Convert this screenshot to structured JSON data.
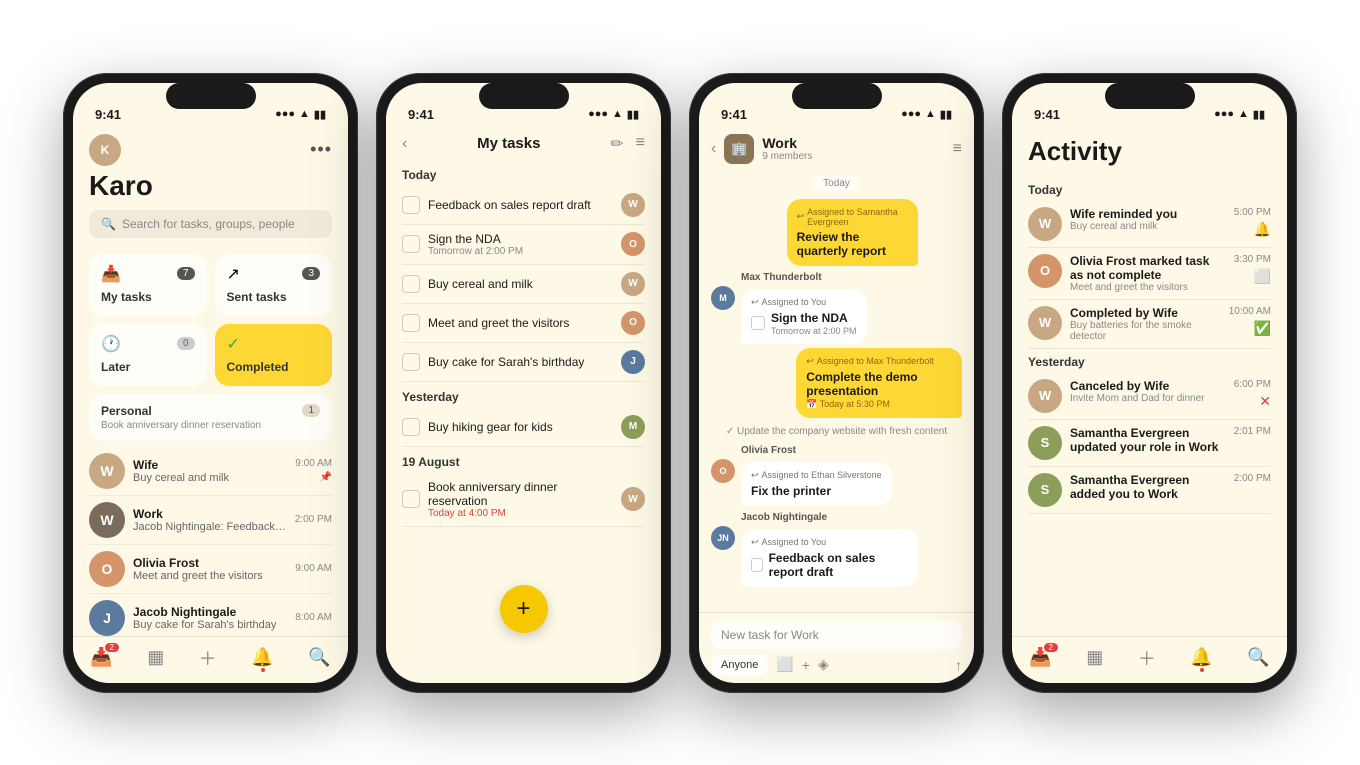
{
  "phones": [
    {
      "id": "phone1",
      "statusBar": {
        "time": "9:41",
        "signal": "●●● ▲ WiFi ▮▮▮"
      },
      "header": {
        "userName": "Karo",
        "searchPlaceholder": "Search for tasks, groups, people"
      },
      "cards": [
        {
          "id": "my-tasks",
          "icon": "📥",
          "label": "My tasks",
          "badge": "7",
          "accent": false
        },
        {
          "id": "sent-tasks",
          "icon": "↗",
          "label": "Sent tasks",
          "badge": "3",
          "accent": false
        },
        {
          "id": "later",
          "icon": "🕐",
          "label": "Later",
          "badge": "0",
          "accent": false
        },
        {
          "id": "completed",
          "icon": "✓",
          "label": "Completed",
          "badge": "",
          "accent": true
        }
      ],
      "section": {
        "title": "Personal",
        "subtitle": "Book anniversary dinner reservation",
        "badge": "1"
      },
      "inboxItems": [
        {
          "id": "wife",
          "name": "Wife",
          "msg": "Buy cereal and milk",
          "time": "9:00 AM",
          "avatarBg": "#c8a882",
          "initial": "W",
          "pinned": true
        },
        {
          "id": "work",
          "name": "Work",
          "msg": "Jacob Nightingale: Feedback on sales rep...",
          "time": "2:00 PM",
          "avatarBg": "#7b6b5a",
          "initial": "W",
          "pinned": false
        },
        {
          "id": "olivia",
          "name": "Olivia Frost",
          "msg": "Meet and greet the visitors",
          "time": "9:00 AM",
          "avatarBg": "#d4956a",
          "initial": "O",
          "pinned": false
        },
        {
          "id": "jacob",
          "name": "Jacob Nightingale",
          "msg": "Buy cake for Sarah's birthday",
          "time": "8:00 AM",
          "avatarBg": "#5a7a9e",
          "initial": "J",
          "pinned": false
        }
      ],
      "nav": [
        {
          "icon": "📥",
          "active": true,
          "badge": "2"
        },
        {
          "icon": "▦",
          "active": false
        },
        {
          "icon": "＋",
          "active": false
        },
        {
          "icon": "🔔",
          "active": false,
          "dot": true
        },
        {
          "icon": "🔍",
          "active": false
        }
      ]
    },
    {
      "id": "phone2",
      "statusBar": {
        "time": "9:41"
      },
      "header": {
        "title": "My tasks"
      },
      "sections": [
        {
          "label": "Today",
          "tasks": [
            {
              "name": "Feedback on sales report draft",
              "sub": "",
              "avatarBg": "#c8a882",
              "initial": "W"
            },
            {
              "name": "Sign the NDA",
              "sub": "Tomorrow at 2:00 PM",
              "avatarBg": "#d4956a",
              "initial": "O"
            },
            {
              "name": "Buy cereal and milk",
              "sub": "",
              "avatarBg": "#c8a882",
              "initial": "W"
            },
            {
              "name": "Meet and greet the visitors",
              "sub": "",
              "avatarBg": "#d4956a",
              "initial": "O"
            },
            {
              "name": "Buy cake for Sarah's birthday",
              "sub": "",
              "avatarBg": "#5a7a9e",
              "initial": "J"
            }
          ]
        },
        {
          "label": "Yesterday",
          "tasks": [
            {
              "name": "Buy hiking gear for kids",
              "sub": "",
              "avatarBg": "#8b9e5a",
              "initial": "M"
            }
          ]
        },
        {
          "label": "19 August",
          "tasks": [
            {
              "name": "Book anniversary dinner reservation",
              "sub": "Today at 4:00 PM",
              "subRed": true,
              "avatarBg": "#c8a882",
              "initial": "W"
            }
          ]
        }
      ],
      "fab": "+"
    },
    {
      "id": "phone3",
      "statusBar": {
        "time": "9:41"
      },
      "header": {
        "title": "Work",
        "sub": "9 members"
      },
      "messages": [
        {
          "type": "date",
          "text": "Today"
        },
        {
          "type": "outgoing-task",
          "assigned": "Assigned to Samantha Evergreen",
          "taskName": "Review the quarterly report",
          "taskSub": ""
        },
        {
          "type": "incoming-block",
          "sender": "Max Thunderbolt",
          "avatarBg": "#5a7a9e",
          "initial": "M",
          "bubbles": [
            {
              "assigned": "Assigned to You",
              "taskName": "Sign the NDA",
              "taskSub": "Tomorrow at 2:00 PM",
              "checkbox": true
            }
          ]
        },
        {
          "type": "incoming-block",
          "sender": "",
          "avatarBg": "#5a7a9e",
          "initial": "M",
          "bubbles": [
            {
              "assigned": "Assigned to Max Thunderbolt",
              "taskName": "Complete the demo presentation",
              "taskSub": "Today at 5:30 PM",
              "taskSubRed": false,
              "checkbox": false,
              "yellow": true
            }
          ]
        },
        {
          "type": "update",
          "text": "✓ Update the company website with fresh content"
        },
        {
          "type": "incoming-block",
          "sender": "Olivia Frost",
          "avatarBg": "#d4956a",
          "initial": "O",
          "bubbles": [
            {
              "assigned": "Assigned to Ethan Silverstone",
              "taskName": "Fix the printer",
              "taskSub": "",
              "checkbox": false
            }
          ]
        },
        {
          "type": "incoming-block",
          "sender": "Jacob Nightingale",
          "avatarBg": "#5a7a9e",
          "initial": "JN",
          "bubbles": [
            {
              "assigned": "Assigned to You",
              "taskName": "Feedback on sales report draft",
              "taskSub": "",
              "checkbox": true
            }
          ]
        }
      ],
      "newTask": {
        "placeholder": "New task for Work"
      },
      "toolbar": [
        {
          "label": "Anyone",
          "type": "button"
        },
        {
          "icon": "⬜",
          "type": "icon"
        },
        {
          "icon": "+",
          "type": "icon"
        },
        {
          "icon": "◈",
          "type": "icon"
        },
        {
          "icon": "↑",
          "type": "icon"
        }
      ]
    },
    {
      "id": "phone4",
      "statusBar": {
        "time": "9:41"
      },
      "header": {
        "title": "Activity"
      },
      "sections": [
        {
          "label": "Today",
          "items": [
            {
              "actor": "Wife reminded you",
              "sub": "Buy cereal and milk",
              "time": "5:00 PM",
              "iconType": "bell",
              "avatarBg": "#c8a882",
              "initial": "W"
            },
            {
              "actor": "Olivia Frost marked task as not complete",
              "sub": "Meet and greet the visitors",
              "time": "3:30 PM",
              "iconType": "box",
              "avatarBg": "#d4956a",
              "initial": "O"
            },
            {
              "actor": "Completed by Wife",
              "sub": "Buy batteries for the smoke detector",
              "time": "10:00 AM",
              "iconType": "check",
              "avatarBg": "#c8a882",
              "initial": "W"
            }
          ]
        },
        {
          "label": "Yesterday",
          "items": [
            {
              "actor": "Canceled by Wife",
              "sub": "Invite Mom and Dad for dinner",
              "time": "6:00 PM",
              "iconType": "x",
              "avatarBg": "#c8a882",
              "initial": "W"
            },
            {
              "actor": "Samantha Evergreen updated your role in Work",
              "sub": "",
              "time": "2:01 PM",
              "iconType": "none",
              "avatarBg": "#8b9e5a",
              "initial": "S"
            },
            {
              "actor": "Samantha Evergreen added you to Work",
              "sub": "",
              "time": "2:00 PM",
              "iconType": "none",
              "avatarBg": "#8b9e5a",
              "initial": "S"
            }
          ]
        }
      ],
      "nav": [
        {
          "icon": "📥",
          "active": true,
          "badge": "2"
        },
        {
          "icon": "▦",
          "active": false
        },
        {
          "icon": "＋",
          "active": false
        },
        {
          "icon": "🔔",
          "active": false,
          "dot": true
        },
        {
          "icon": "🔍",
          "active": false
        }
      ]
    }
  ]
}
